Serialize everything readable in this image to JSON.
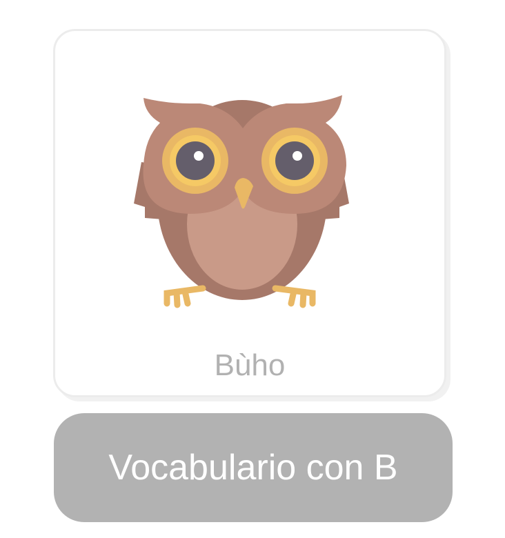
{
  "card": {
    "word": "Bùho",
    "image": "owl-illustration"
  },
  "button": {
    "label": "Vocabulario con B"
  },
  "colors": {
    "button_bg": "#b2b2b2",
    "word_text": "#b1b1b1",
    "owl_body": "#a67869",
    "owl_head": "#bb8877",
    "owl_belly": "#c99a88",
    "owl_eye_ring": "#e9b865",
    "owl_pupil": "#645e6b"
  }
}
